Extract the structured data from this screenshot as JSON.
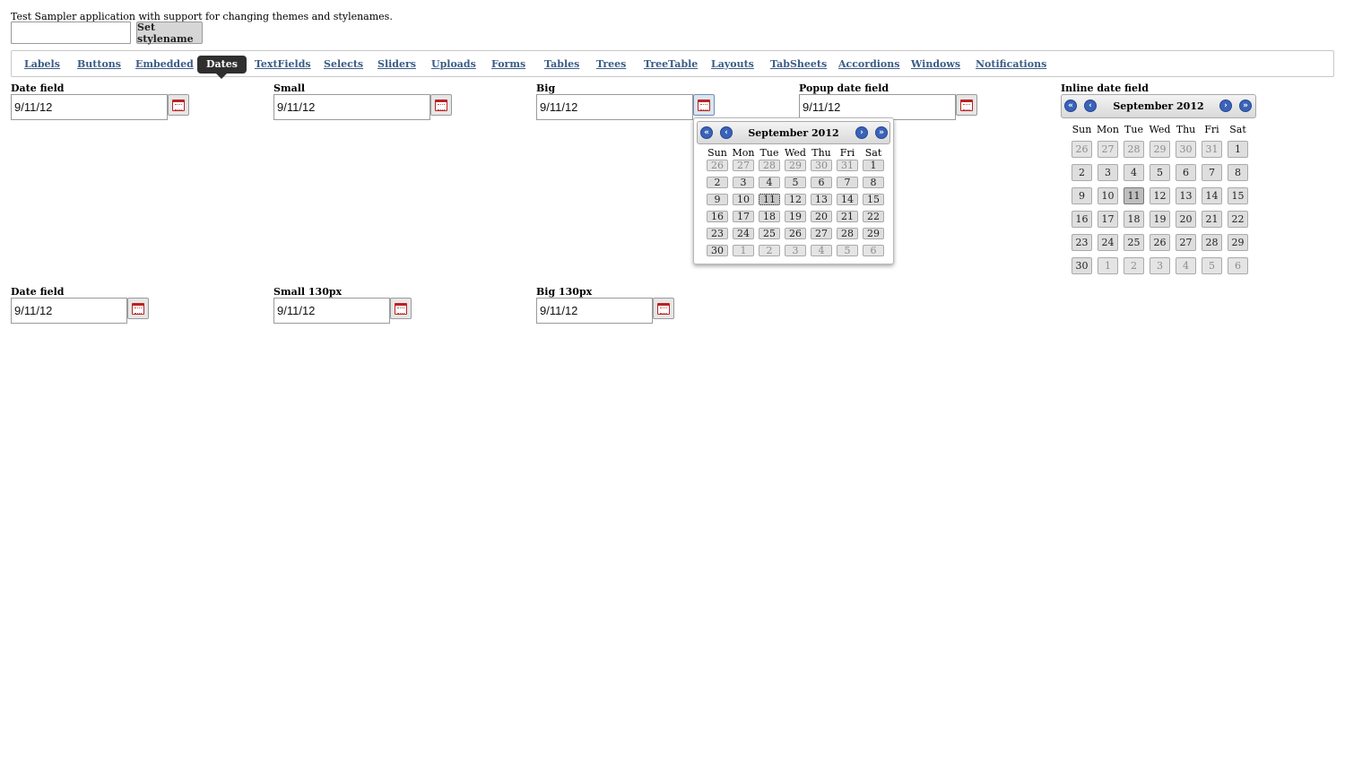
{
  "header": {
    "intro_text": "Test Sampler application with support for changing themes and stylenames.",
    "stylename_value": "",
    "set_stylename_label": "Set stylename"
  },
  "nav": {
    "items": [
      "Labels",
      "Buttons",
      "Embedded",
      "Dates",
      "TextFields",
      "Selects",
      "Sliders",
      "Uploads",
      "Forms",
      "Tables",
      "Trees",
      "TreeTable",
      "Layouts",
      "TabSheets",
      "Accordions",
      "Windows",
      "Notifications"
    ],
    "active": "Dates"
  },
  "date_fields": {
    "date_field": {
      "caption": "Date field",
      "value": "9/11/12"
    },
    "small": {
      "caption": "Small",
      "value": "9/11/12"
    },
    "big": {
      "caption": "Big",
      "value": "9/11/12"
    },
    "popup": {
      "caption": "Popup date field",
      "value": "9/11/12"
    },
    "inline": {
      "caption": "Inline date field"
    },
    "date_field_2": {
      "caption": "Date field",
      "value": "9/11/12"
    },
    "small_130": {
      "caption": "Small 130px",
      "value": "9/11/12"
    },
    "big_130": {
      "caption": "Big 130px",
      "value": "9/11/12"
    }
  },
  "calendar": {
    "month_label": "September 2012",
    "weekdays": [
      "Sun",
      "Mon",
      "Tue",
      "Wed",
      "Thu",
      "Fri",
      "Sat"
    ],
    "weeks": [
      [
        26,
        27,
        28,
        29,
        30,
        31,
        1
      ],
      [
        2,
        3,
        4,
        5,
        6,
        7,
        8
      ],
      [
        9,
        10,
        11,
        12,
        13,
        14,
        15
      ],
      [
        16,
        17,
        18,
        19,
        20,
        21,
        22
      ],
      [
        23,
        24,
        25,
        26,
        27,
        28,
        29
      ],
      [
        30,
        1,
        2,
        3,
        4,
        5,
        6
      ]
    ],
    "selected_day": 11,
    "icons": {
      "prev_year": "double-arrow-left-icon",
      "prev_month": "arrow-left-icon",
      "next_month": "arrow-right-icon",
      "next_year": "double-arrow-right-icon"
    }
  },
  "icons": {
    "calendar_button": "calendar-icon"
  },
  "colors": {
    "nav_link": "#3b5c86",
    "nav_active_bg": "#2f2f2f",
    "nav_button": "#3a63b8"
  }
}
